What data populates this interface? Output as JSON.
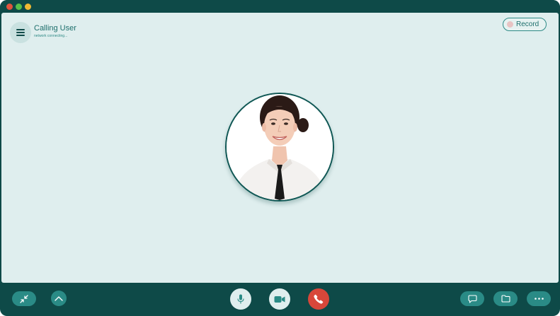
{
  "call": {
    "title": "Calling User",
    "status": "network connecting..."
  },
  "record": {
    "label": "Record"
  },
  "colors": {
    "frame": "#0e4a48",
    "stage": "#dfeeee",
    "accent": "#2a8b86",
    "end_call": "#d8473a",
    "record_dot": "#e8c3c3"
  },
  "icons": {
    "left_toolbar": [
      "minimize-arrows-icon",
      "chevron-up-icon"
    ],
    "center_controls": [
      "microphone-icon",
      "video-camera-icon",
      "end-call-phone-icon"
    ],
    "right_toolbar": [
      "chat-bubble-icon",
      "folder-icon",
      "more-options-icon"
    ]
  }
}
